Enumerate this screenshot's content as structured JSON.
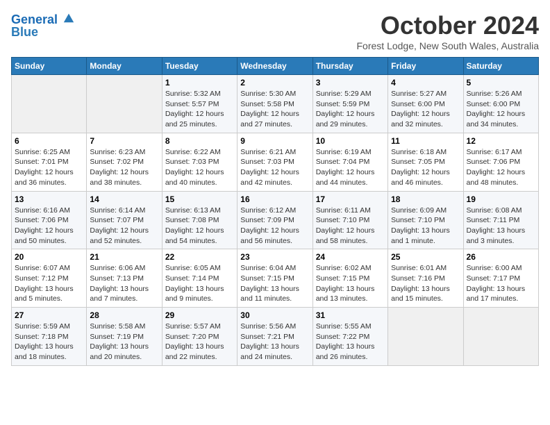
{
  "app": {
    "logo_line1": "General",
    "logo_line2": "Blue"
  },
  "header": {
    "month": "October 2024",
    "location": "Forest Lodge, New South Wales, Australia"
  },
  "days_of_week": [
    "Sunday",
    "Monday",
    "Tuesday",
    "Wednesday",
    "Thursday",
    "Friday",
    "Saturday"
  ],
  "weeks": [
    [
      {
        "day": "",
        "info": ""
      },
      {
        "day": "",
        "info": ""
      },
      {
        "day": "1",
        "info": "Sunrise: 5:32 AM\nSunset: 5:57 PM\nDaylight: 12 hours\nand 25 minutes."
      },
      {
        "day": "2",
        "info": "Sunrise: 5:30 AM\nSunset: 5:58 PM\nDaylight: 12 hours\nand 27 minutes."
      },
      {
        "day": "3",
        "info": "Sunrise: 5:29 AM\nSunset: 5:59 PM\nDaylight: 12 hours\nand 29 minutes."
      },
      {
        "day": "4",
        "info": "Sunrise: 5:27 AM\nSunset: 6:00 PM\nDaylight: 12 hours\nand 32 minutes."
      },
      {
        "day": "5",
        "info": "Sunrise: 5:26 AM\nSunset: 6:00 PM\nDaylight: 12 hours\nand 34 minutes."
      }
    ],
    [
      {
        "day": "6",
        "info": "Sunrise: 6:25 AM\nSunset: 7:01 PM\nDaylight: 12 hours\nand 36 minutes."
      },
      {
        "day": "7",
        "info": "Sunrise: 6:23 AM\nSunset: 7:02 PM\nDaylight: 12 hours\nand 38 minutes."
      },
      {
        "day": "8",
        "info": "Sunrise: 6:22 AM\nSunset: 7:03 PM\nDaylight: 12 hours\nand 40 minutes."
      },
      {
        "day": "9",
        "info": "Sunrise: 6:21 AM\nSunset: 7:03 PM\nDaylight: 12 hours\nand 42 minutes."
      },
      {
        "day": "10",
        "info": "Sunrise: 6:19 AM\nSunset: 7:04 PM\nDaylight: 12 hours\nand 44 minutes."
      },
      {
        "day": "11",
        "info": "Sunrise: 6:18 AM\nSunset: 7:05 PM\nDaylight: 12 hours\nand 46 minutes."
      },
      {
        "day": "12",
        "info": "Sunrise: 6:17 AM\nSunset: 7:06 PM\nDaylight: 12 hours\nand 48 minutes."
      }
    ],
    [
      {
        "day": "13",
        "info": "Sunrise: 6:16 AM\nSunset: 7:06 PM\nDaylight: 12 hours\nand 50 minutes."
      },
      {
        "day": "14",
        "info": "Sunrise: 6:14 AM\nSunset: 7:07 PM\nDaylight: 12 hours\nand 52 minutes."
      },
      {
        "day": "15",
        "info": "Sunrise: 6:13 AM\nSunset: 7:08 PM\nDaylight: 12 hours\nand 54 minutes."
      },
      {
        "day": "16",
        "info": "Sunrise: 6:12 AM\nSunset: 7:09 PM\nDaylight: 12 hours\nand 56 minutes."
      },
      {
        "day": "17",
        "info": "Sunrise: 6:11 AM\nSunset: 7:10 PM\nDaylight: 12 hours\nand 58 minutes."
      },
      {
        "day": "18",
        "info": "Sunrise: 6:09 AM\nSunset: 7:10 PM\nDaylight: 13 hours\nand 1 minute."
      },
      {
        "day": "19",
        "info": "Sunrise: 6:08 AM\nSunset: 7:11 PM\nDaylight: 13 hours\nand 3 minutes."
      }
    ],
    [
      {
        "day": "20",
        "info": "Sunrise: 6:07 AM\nSunset: 7:12 PM\nDaylight: 13 hours\nand 5 minutes."
      },
      {
        "day": "21",
        "info": "Sunrise: 6:06 AM\nSunset: 7:13 PM\nDaylight: 13 hours\nand 7 minutes."
      },
      {
        "day": "22",
        "info": "Sunrise: 6:05 AM\nSunset: 7:14 PM\nDaylight: 13 hours\nand 9 minutes."
      },
      {
        "day": "23",
        "info": "Sunrise: 6:04 AM\nSunset: 7:15 PM\nDaylight: 13 hours\nand 11 minutes."
      },
      {
        "day": "24",
        "info": "Sunrise: 6:02 AM\nSunset: 7:15 PM\nDaylight: 13 hours\nand 13 minutes."
      },
      {
        "day": "25",
        "info": "Sunrise: 6:01 AM\nSunset: 7:16 PM\nDaylight: 13 hours\nand 15 minutes."
      },
      {
        "day": "26",
        "info": "Sunrise: 6:00 AM\nSunset: 7:17 PM\nDaylight: 13 hours\nand 17 minutes."
      }
    ],
    [
      {
        "day": "27",
        "info": "Sunrise: 5:59 AM\nSunset: 7:18 PM\nDaylight: 13 hours\nand 18 minutes."
      },
      {
        "day": "28",
        "info": "Sunrise: 5:58 AM\nSunset: 7:19 PM\nDaylight: 13 hours\nand 20 minutes."
      },
      {
        "day": "29",
        "info": "Sunrise: 5:57 AM\nSunset: 7:20 PM\nDaylight: 13 hours\nand 22 minutes."
      },
      {
        "day": "30",
        "info": "Sunrise: 5:56 AM\nSunset: 7:21 PM\nDaylight: 13 hours\nand 24 minutes."
      },
      {
        "day": "31",
        "info": "Sunrise: 5:55 AM\nSunset: 7:22 PM\nDaylight: 13 hours\nand 26 minutes."
      },
      {
        "day": "",
        "info": ""
      },
      {
        "day": "",
        "info": ""
      }
    ]
  ]
}
